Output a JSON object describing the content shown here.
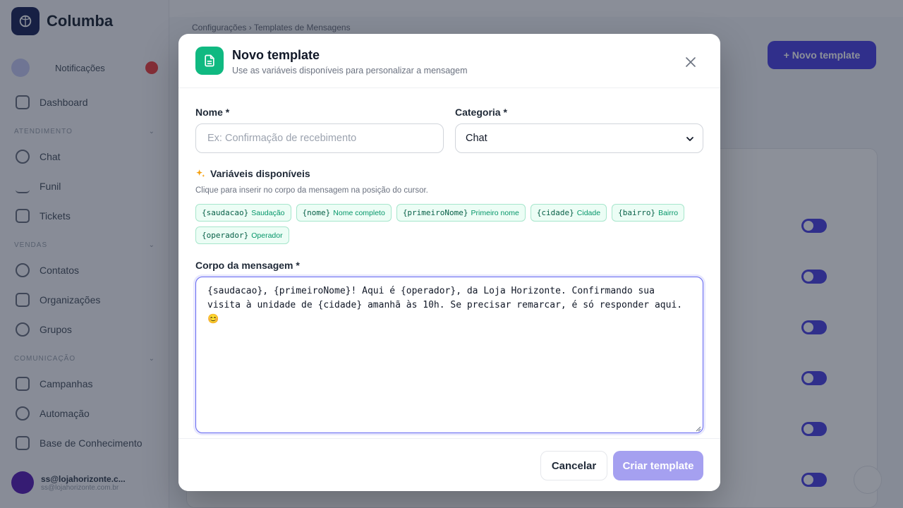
{
  "background": {
    "brand": {
      "name": "Columba"
    },
    "notifications": {
      "label": "Notificações"
    },
    "sidebar": {
      "items": [
        {
          "label": "Dashboard",
          "icon": "grid-icon"
        },
        {
          "label": "Chat",
          "icon": "chat-icon"
        },
        {
          "label": "Funil",
          "icon": "funnel-icon"
        },
        {
          "label": "Tickets",
          "icon": "ticket-icon"
        },
        {
          "label": "Contatos",
          "icon": "contacts-icon"
        },
        {
          "label": "Organizações",
          "icon": "building-icon"
        },
        {
          "label": "Grupos",
          "icon": "group-icon"
        },
        {
          "label": "Campanhas",
          "icon": "megaphone-icon"
        },
        {
          "label": "Automação",
          "icon": "phone-icon"
        },
        {
          "label": "Base de Conhecimento",
          "icon": "book-icon"
        }
      ],
      "sections": [
        "ATENDIMENTO",
        "VENDAS",
        "COMUNICAÇÃO"
      ],
      "user": {
        "email": "ss@lojahorizonte.c...",
        "subtitle": "ss@lojahorizonte.com.br"
      }
    },
    "main": {
      "breadcrumb": "Configurações  ›  Templates de Mensagens",
      "new_button": "+ Novo template"
    }
  },
  "modal": {
    "title": "Novo template",
    "subtitle": "Use as variáveis disponíveis para personalizar a mensagem",
    "name_label": "Nome *",
    "name_placeholder": "Ex: Confirmação de recebimento",
    "name_value": "",
    "category_label": "Categoria *",
    "category_value": "Chat",
    "variables_title": "Variáveis disponíveis",
    "variables_hint": "Clique para inserir no corpo da mensagem na posição do cursor.",
    "variables": [
      {
        "key": "{saudacao}",
        "desc": "Saudação"
      },
      {
        "key": "{nome}",
        "desc": "Nome completo"
      },
      {
        "key": "{primeiroNome}",
        "desc": "Primeiro nome"
      },
      {
        "key": "{cidade}",
        "desc": "Cidade"
      },
      {
        "key": "{bairro}",
        "desc": "Bairro"
      },
      {
        "key": "{operador}",
        "desc": "Operador"
      }
    ],
    "body_label": "Corpo da mensagem *",
    "body_value": "{saudacao}, {primeiroNome}! Aqui é {operador}, da Loja Horizonte. Confirmando sua visita à unidade de {cidade} amanhã às 10h. Se precisar remarcar, é só responder aqui. 😊",
    "cancel_label": "Cancelar",
    "create_label": "Criar template"
  },
  "colors": {
    "accent": "#4f46e5",
    "modal_icon": "#10b981",
    "chip_bg": "#ecfdf5",
    "create_disabled": "#a5a0f0"
  }
}
